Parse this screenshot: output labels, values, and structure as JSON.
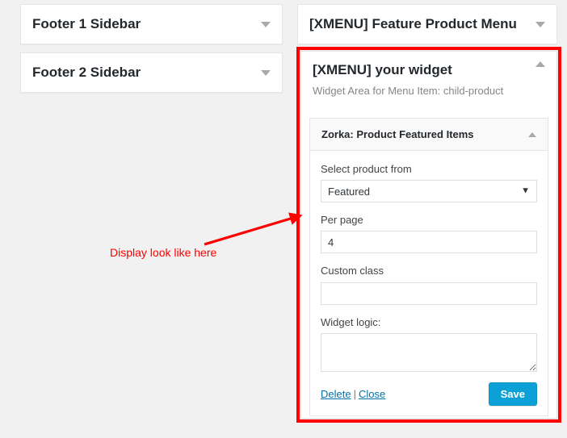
{
  "page": {
    "background_color": "#f1f1f1",
    "accent_color": "#0ca1d6",
    "annotation_color": "#ff0000",
    "link_color": "#0073aa"
  },
  "left_column": {
    "panels": [
      {
        "title": "Footer 1 Sidebar",
        "toggle_icon": "chevron-down-icon",
        "state": "collapsed"
      },
      {
        "title": "Footer 2 Sidebar",
        "toggle_icon": "chevron-down-icon",
        "state": "collapsed"
      }
    ]
  },
  "right_column": {
    "feature_panel": {
      "title": "[XMENU] Feature Product Menu",
      "toggle_icon": "chevron-down-icon",
      "state": "collapsed"
    },
    "your_widget_panel": {
      "title": "[XMENU] your widget",
      "subtitle": "Widget Area for Menu Item: child-product",
      "toggle_icon": "chevron-up-icon",
      "state": "expanded",
      "widget": {
        "title": "Zorka: Product Featured Items",
        "toggle_icon": "chevron-up-icon",
        "state": "expanded",
        "fields": {
          "select_product_from": {
            "label": "Select product from",
            "value": "Featured",
            "options": [
              "Featured"
            ],
            "caret_glyph": "▼"
          },
          "per_page": {
            "label": "Per page",
            "value": "4",
            "placeholder": ""
          },
          "custom_class": {
            "label": "Custom class",
            "value": "",
            "placeholder": ""
          },
          "widget_logic": {
            "label": "Widget logic:",
            "value": "",
            "placeholder": ""
          }
        },
        "footer": {
          "delete_label": "Delete",
          "separator": "|",
          "close_label": "Close",
          "save_label": "Save"
        }
      }
    }
  },
  "annotation": {
    "text": "Display look like here",
    "arrow_icon": "arrow-pointing-up-right-icon",
    "highlight_box": "red-outline-around-your-widget-panel"
  }
}
